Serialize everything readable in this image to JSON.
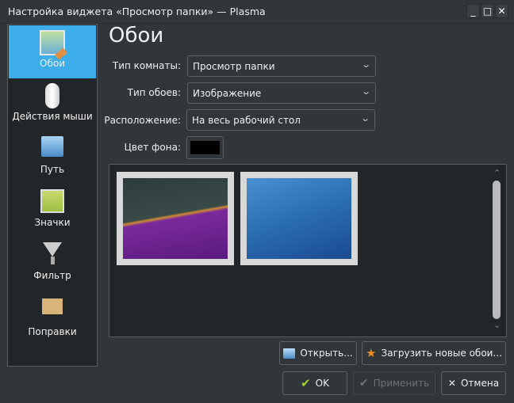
{
  "window": {
    "title": "Настройка виджета «Просмотр папки» — Plasma",
    "minimize": "_",
    "maximize": "□",
    "close": "✕"
  },
  "sidebar": {
    "items": [
      {
        "label": "Обои",
        "icon": "wallpaper-icon",
        "selected": true
      },
      {
        "label": "Действия мыши",
        "icon": "mouse-icon"
      },
      {
        "label": "Путь",
        "icon": "folder-icon"
      },
      {
        "label": "Значки",
        "icon": "icons-icon"
      },
      {
        "label": "Фильтр",
        "icon": "filter-icon"
      },
      {
        "label": "Поправки",
        "icon": "tweaks-icon"
      }
    ]
  },
  "page": {
    "title": "Обои",
    "form": {
      "layout_label": "Тип комнаты:",
      "layout_value": "Просмотр папки",
      "type_label": "Тип обоев:",
      "type_value": "Изображение",
      "position_label": "Расположение:",
      "position_value": "На весь рабочий стол",
      "color_label": "Цвет фона:",
      "color_value": "#000000"
    },
    "scroll_up": "⌃",
    "scroll_down": "⌄",
    "buttons": {
      "open": "Открыть...",
      "download": "Загрузить новые обои..."
    }
  },
  "dialog": {
    "ok": "OK",
    "apply": "Применить",
    "cancel": "Отмена"
  },
  "colors": {
    "accent": "#3daee9",
    "bg": "#31363b",
    "view": "#232629"
  }
}
